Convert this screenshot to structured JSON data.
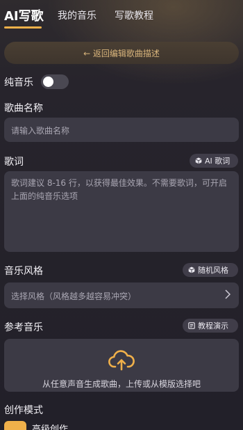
{
  "tabs": [
    {
      "label": "AI写歌",
      "active": true
    },
    {
      "label": "我的音乐",
      "active": false
    },
    {
      "label": "写歌教程",
      "active": false
    }
  ],
  "back_button": "← 返回编辑歌曲描述",
  "pure_music": {
    "label": "纯音乐",
    "enabled": false
  },
  "song_name": {
    "label": "歌曲名称",
    "placeholder": "请输入歌曲名称"
  },
  "lyrics": {
    "label": "歌词",
    "ai_button": "AI 歌词",
    "placeholder": "歌词建议 8-16 行，以获得最佳效果。不需要歌词，可开启上面的纯音乐选项"
  },
  "style": {
    "label": "音乐风格",
    "random_button": "随机风格",
    "select_placeholder": "选择风格（风格越多越容易冲突）"
  },
  "reference": {
    "label": "参考音乐",
    "demo_button": "教程演示",
    "upload_text": "从任意声音生成歌曲，上传或从模版选择吧"
  },
  "mode": {
    "label": "创作模式",
    "option_label": "高级创作"
  },
  "colors": {
    "accent": "#f0b04a",
    "background": "#24222b",
    "field": "#3c3a45"
  }
}
